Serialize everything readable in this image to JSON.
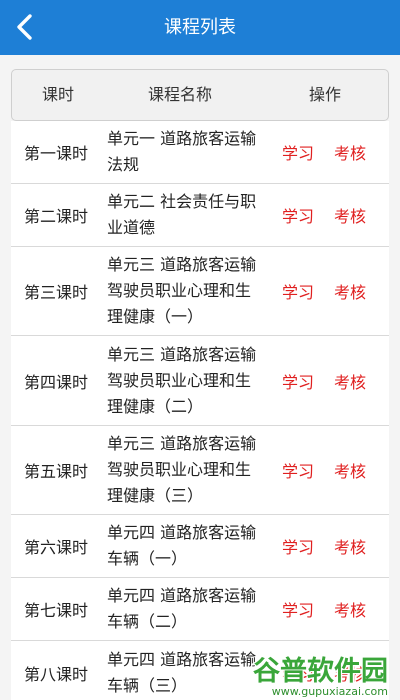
{
  "header": {
    "title": "课程列表",
    "back_icon": "chevron-left-icon",
    "bar_color": "#1e7fd6"
  },
  "table_header": {
    "period": "课时",
    "name": "课程名称",
    "operation": "操作"
  },
  "action_color": "#e02020",
  "rows": [
    {
      "period": "第一课时",
      "name": "单元一 道路旅客运输法规",
      "study": "学习",
      "exam": "考核"
    },
    {
      "period": "第二课时",
      "name": "单元二 社会责任与职业道德",
      "study": "学习",
      "exam": "考核"
    },
    {
      "period": "第三课时",
      "name": "单元三 道路旅客运输驾驶员职业心理和生理健康（一）",
      "study": "学习",
      "exam": "考核"
    },
    {
      "period": "第四课时",
      "name": "单元三 道路旅客运输驾驶员职业心理和生理健康（二）",
      "study": "学习",
      "exam": "考核"
    },
    {
      "period": "第五课时",
      "name": "单元三 道路旅客运输驾驶员职业心理和生理健康（三）",
      "study": "学习",
      "exam": "考核"
    },
    {
      "period": "第六课时",
      "name": "单元四 道路旅客运输车辆（一）",
      "study": "学习",
      "exam": "考核"
    },
    {
      "period": "第七课时",
      "name": "单元四 道路旅客运输车辆（二）",
      "study": "学习",
      "exam": "考核"
    },
    {
      "period": "第八课时",
      "name": "单元四 道路旅客运输车辆（三）",
      "study": "学习",
      "exam": "考核"
    }
  ],
  "watermark": {
    "brand": "谷普软件园",
    "url": "www.gupuxiazai.com"
  }
}
